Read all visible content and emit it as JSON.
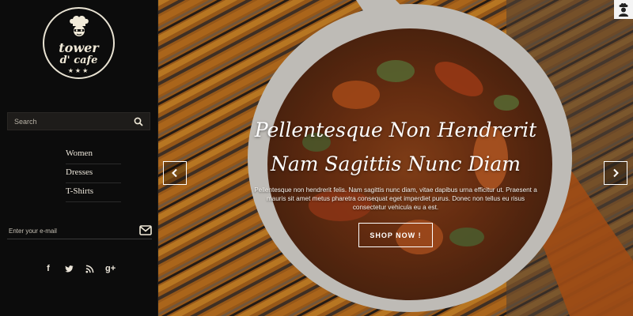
{
  "logo": {
    "line1": "tower",
    "line2": "d' cafe",
    "stars": "★★★",
    "icon": "chef-icon"
  },
  "search": {
    "placeholder": "Search",
    "icon": "search-icon"
  },
  "menu": {
    "items": [
      {
        "label": "Women"
      },
      {
        "label": "Dresses"
      },
      {
        "label": "T-Shirts"
      }
    ]
  },
  "newsletter": {
    "placeholder": "Enter your e-mail",
    "icon": "envelope-icon"
  },
  "social": [
    {
      "name": "facebook-icon",
      "glyph": "f"
    },
    {
      "name": "twitter-icon",
      "glyph": ""
    },
    {
      "name": "rss-icon",
      "glyph": ""
    },
    {
      "name": "google-plus-icon",
      "glyph": "g+"
    }
  ],
  "hero": {
    "title_line1": "Pellentesque Non Hendrerit",
    "title_line2": "Nam Sagittis Nunc Diam",
    "text": "Pellentesque non hendrerit felis. Nam sagittis nunc diam, vitae dapibus urna efficitur ut. Praesent a mauris sit amet metus pharetra consequat eget imperdiet purus. Donec non tellus eu risus consectetur vehicula eu a est.",
    "button_label": "SHOP NOW !"
  },
  "colors": {
    "sidebar_bg": "#0c0c0c",
    "accent_cream": "#f1ead8",
    "search_bg": "#1e1c1a"
  }
}
